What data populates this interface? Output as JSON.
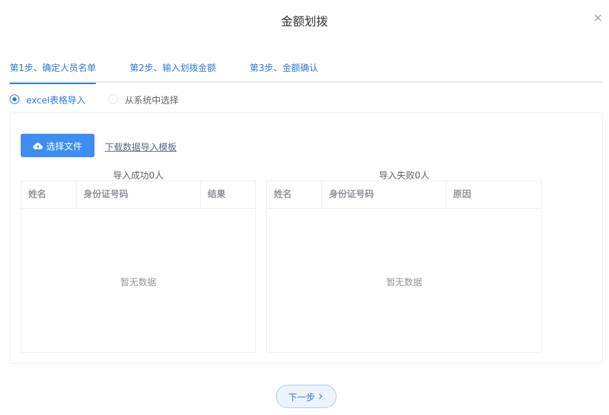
{
  "dialog": {
    "title": "金额划拨",
    "close_icon": "close-icon"
  },
  "tabs": [
    {
      "label": "第1步、确定人员名单",
      "active": true
    },
    {
      "label": "第2步、输入划拨金额",
      "active": false
    },
    {
      "label": "第3步、金额确认",
      "active": false
    }
  ],
  "import_mode": {
    "options": [
      {
        "label": "excel表格导入",
        "checked": true
      },
      {
        "label": "从系统中选择",
        "checked": false
      }
    ]
  },
  "upload": {
    "button_label": "选择文件",
    "button_icon": "cloud-upload-icon",
    "template_link": "下载数据导入模板"
  },
  "success_table": {
    "caption": "导入成功0人",
    "columns": [
      "姓名",
      "身份证号码",
      "结果"
    ],
    "rows": [],
    "empty_text": "暂无数据"
  },
  "failure_table": {
    "caption": "导入失败0人",
    "columns": [
      "姓名",
      "身份证号码",
      "原因"
    ],
    "rows": [],
    "empty_text": "暂无数据"
  },
  "footer": {
    "next_label": "下一步",
    "next_icon": "chevron-right-icon"
  },
  "colors": {
    "primary": "#2b7ad8",
    "button": "#3d8ef0",
    "border": "#ebeef5"
  }
}
